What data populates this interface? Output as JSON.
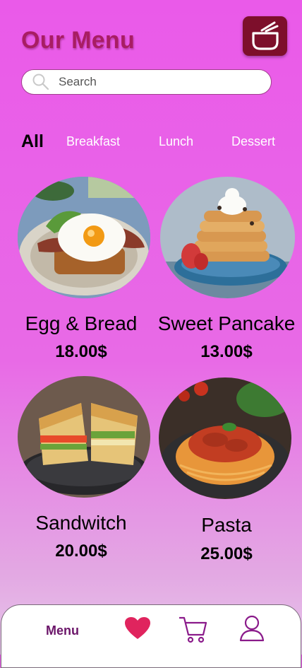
{
  "header": {
    "title": "Our Menu",
    "logo_icon": "bowl-icon"
  },
  "search": {
    "placeholder": "Search",
    "value": ""
  },
  "categories": {
    "items": [
      "All",
      "Breakfast",
      "Lunch",
      "Dessert"
    ],
    "selected": "All"
  },
  "menu": {
    "items": [
      {
        "name": "Egg & Bread",
        "price": "18.00$",
        "image": "egg-bread-photo"
      },
      {
        "name": "Sweet Pancake",
        "price": "13.00$",
        "image": "pancake-photo"
      },
      {
        "name": "Sandwitch",
        "price": "20.00$",
        "image": "sandwich-photo"
      },
      {
        "name": "Pasta",
        "price": "25.00$",
        "image": "pasta-photo"
      }
    ]
  },
  "bottom_nav": {
    "menu_label": "Menu",
    "icons": [
      "heart-icon",
      "cart-icon",
      "user-icon"
    ]
  },
  "colors": {
    "background": "#ea5ae9",
    "title": "#a81d63",
    "logo_bg": "#7d0f2b",
    "nav_active": "#6b1569",
    "heart": "#e0245e",
    "nav_icon": "#8a1a8a"
  }
}
